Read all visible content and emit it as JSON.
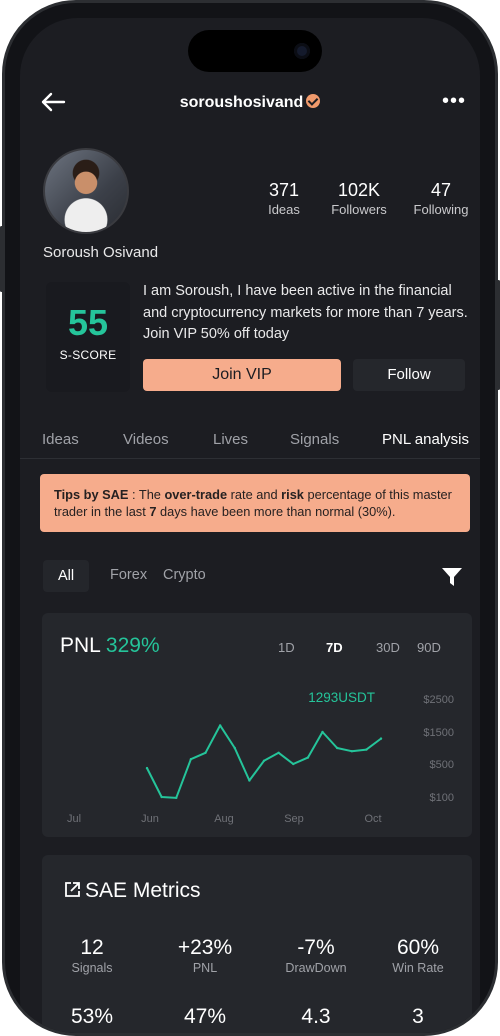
{
  "header": {
    "username": "soroushosivand",
    "back_icon": "arrow-left-icon",
    "more_icon": "more-horizontal-icon"
  },
  "profile": {
    "full_name": "Soroush Osivand",
    "stats": [
      {
        "value": "371",
        "label": "Ideas"
      },
      {
        "value": "102K",
        "label": "Followers"
      },
      {
        "value": "47",
        "label": "Following"
      }
    ],
    "score": {
      "value": "55",
      "label": "S-SCORE"
    },
    "bio": "I am Soroush, I have been active in the financial and cryptocurrency markets for more than 7 years.  Join VIP 50% off today",
    "join_label": "Join VIP",
    "follow_label": "Follow"
  },
  "tabs": [
    "Ideas",
    "Videos",
    "Lives",
    "Signals",
    "PNL analysis"
  ],
  "tips": {
    "prefix": "Tips by SAE",
    "t1": " : The ",
    "b1": "over-trade",
    "t2": " rate and ",
    "b2": "risk",
    "t3": " percentage of this master trader in the last ",
    "b3": "7",
    "t4": " days have been more than normal (30%)."
  },
  "filters": {
    "options": [
      "All",
      "Forex",
      "Crypto"
    ],
    "selected": "All"
  },
  "pnl": {
    "label": "PNL",
    "value": "329%",
    "ranges": [
      "1D",
      "7D",
      "30D",
      "90D"
    ],
    "selected_range": "7D"
  },
  "chart_data": {
    "type": "line",
    "title": "",
    "x_tick_labels": [
      "Jul",
      "Jun",
      "Aug",
      "Sep",
      "Oct"
    ],
    "y_tick_labels": [
      "$2500",
      "$1500",
      "$500",
      "$100"
    ],
    "y_tick_values": [
      2500,
      1500,
      500,
      100
    ],
    "series": [
      {
        "values": [
          450,
          100,
          90,
          650,
          850,
          1700,
          1000,
          300,
          600,
          850,
          500,
          700,
          1500,
          1000,
          900,
          950,
          1293
        ],
        "color": "#25c49a"
      }
    ],
    "end_label": "1293USDT",
    "grid": false
  },
  "metrics": {
    "title": "SAE Metrics",
    "items": [
      {
        "value": "12",
        "label": "Signals"
      },
      {
        "value": "+23%",
        "label": "PNL"
      },
      {
        "value": "-7%",
        "label": "DrawDown"
      },
      {
        "value": "60%",
        "label": "Win Rate"
      },
      {
        "value": "53%",
        "label": ""
      },
      {
        "value": "47%",
        "label": ""
      },
      {
        "value": "4.3",
        "label": ""
      },
      {
        "value": "3",
        "label": ""
      }
    ]
  },
  "colors": {
    "accent": "#25c49a",
    "primary_button": "#f6ac8c",
    "background": "#1c1d22",
    "card": "#25272c"
  }
}
